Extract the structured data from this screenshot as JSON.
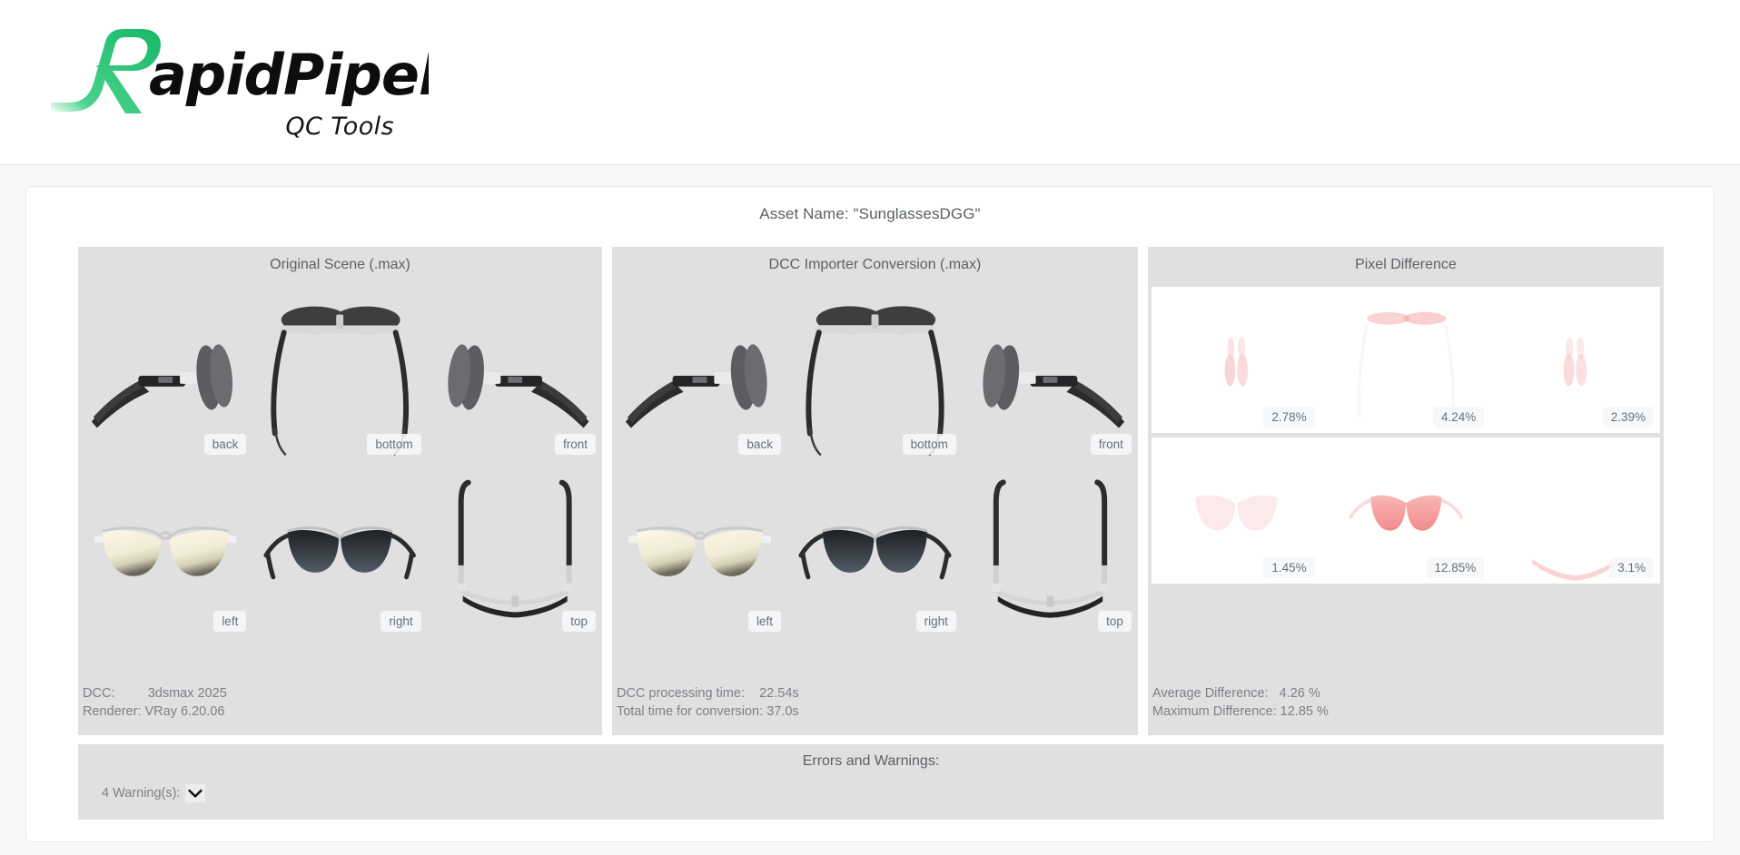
{
  "header": {
    "logo_text": "RapidPipeline",
    "logo_accent_color": "#2ecc84",
    "subtitle": "QC Tools"
  },
  "report": {
    "asset_name_label": "Asset Name: \"SunglassesDGG\"",
    "panels": {
      "original": {
        "title": "Original Scene (.max)",
        "views": [
          "back",
          "bottom",
          "front",
          "left",
          "right",
          "top"
        ],
        "footer": [
          {
            "key": "DCC:         ",
            "value": "3dsmax 2025"
          },
          {
            "key": "Renderer: ",
            "value": "VRay 6.20.06"
          }
        ]
      },
      "conversion": {
        "title": "DCC Importer Conversion (.max)",
        "views": [
          "back",
          "bottom",
          "front",
          "left",
          "right",
          "top"
        ],
        "footer": [
          {
            "key": "DCC processing time:    ",
            "value": "22.54s"
          },
          {
            "key": "Total time for conversion: ",
            "value": "37.0s"
          }
        ]
      },
      "difference": {
        "title": "Pixel Difference",
        "values": [
          "2.78%",
          "4.24%",
          "2.39%",
          "1.45%",
          "12.85%",
          "3.1%"
        ],
        "footer": [
          {
            "key": "Average Difference:   ",
            "value": "4.26 %"
          },
          {
            "key": "Maximum Difference: ",
            "value": "12.85 %"
          }
        ],
        "heat_color": "#f4a0a0"
      }
    }
  },
  "errors": {
    "title": "Errors and Warnings:",
    "warnings_count_label": "4 Warning(s):",
    "toggle_icon": "chevron-down-icon"
  }
}
